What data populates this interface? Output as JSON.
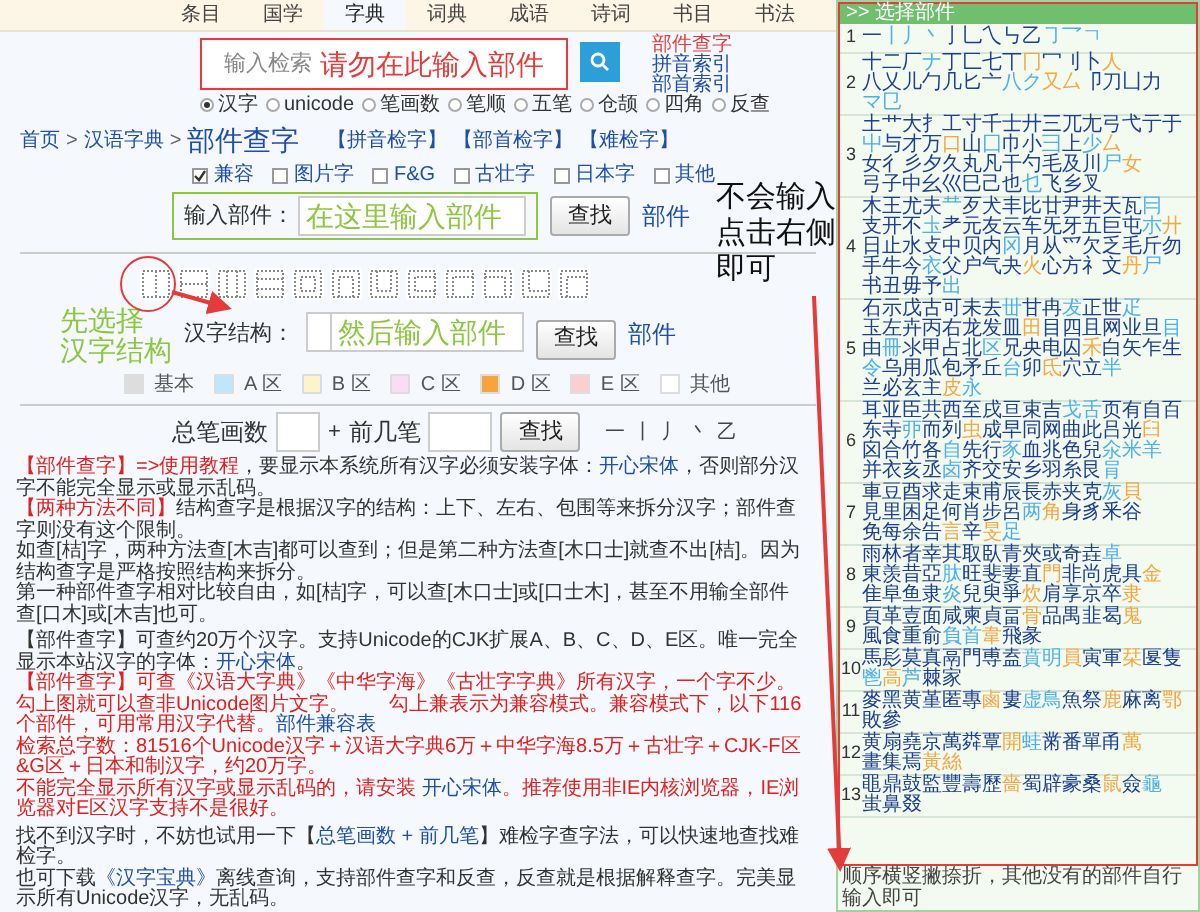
{
  "nav": [
    {
      "label": "条目",
      "selected": false
    },
    {
      "label": "国学",
      "selected": false
    },
    {
      "label": "字典",
      "selected": true
    },
    {
      "label": "词典",
      "selected": false
    },
    {
      "label": "成语",
      "selected": false
    },
    {
      "label": "诗词",
      "selected": false
    },
    {
      "label": "书目",
      "selected": false
    },
    {
      "label": "书法",
      "selected": false
    }
  ],
  "search": {
    "placeholder": "输入检索",
    "annotation": "请勿在此输入部件",
    "links": [
      {
        "label": "部件查字",
        "selected": true
      },
      {
        "label": "拼音索引",
        "selected": false
      },
      {
        "label": "部首索引",
        "selected": false
      }
    ],
    "modes": [
      {
        "label": "汉字",
        "selected": true
      },
      {
        "label": "unicode",
        "selected": false
      },
      {
        "label": "笔画数",
        "selected": false
      },
      {
        "label": "笔顺",
        "selected": false
      },
      {
        "label": "五笔",
        "selected": false
      },
      {
        "label": "仓颉",
        "selected": false
      },
      {
        "label": "四角",
        "selected": false
      },
      {
        "label": "反查",
        "selected": false
      }
    ]
  },
  "breadcrumb": {
    "items": [
      "首页",
      "汉语字典"
    ],
    "separator": ">",
    "current": "部件查字",
    "quick_links": [
      "【拼音检字】",
      "【部首检字】",
      "【难检字】"
    ]
  },
  "filters": [
    {
      "label": "兼容",
      "checked": true
    },
    {
      "label": "图片字",
      "checked": false
    },
    {
      "label": "F&G",
      "checked": false
    },
    {
      "label": "古壮字",
      "checked": false
    },
    {
      "label": "日本字",
      "checked": false
    },
    {
      "label": "其他",
      "checked": false
    }
  ],
  "part_search": {
    "label": "输入部件：",
    "placeholder": "在这里输入部件",
    "button": "查找",
    "link": "部件"
  },
  "side_annotation": [
    "不会输入",
    "点击右侧",
    "即可"
  ],
  "structures": [
    {
      "kind": "left-right"
    },
    {
      "kind": "top-bottom"
    },
    {
      "kind": "left-middle-right"
    },
    {
      "kind": "top-middle-bottom"
    },
    {
      "kind": "enclose"
    },
    {
      "kind": "open-bottom"
    },
    {
      "kind": "open-top"
    },
    {
      "kind": "open-right"
    },
    {
      "kind": "top-left"
    },
    {
      "kind": "top-right"
    },
    {
      "kind": "bottom-left"
    },
    {
      "kind": "overlap"
    }
  ],
  "structure_search": {
    "annotation": [
      "先选择",
      "汉字结构"
    ],
    "label": "汉字结构：",
    "placeholder": "然后输入部件",
    "button": "查找",
    "link": "部件"
  },
  "legend": [
    {
      "label": "基本",
      "color": "#dddddd"
    },
    {
      "label": "A 区",
      "color": "#bfe6fb"
    },
    {
      "label": "B 区",
      "color": "#fdf5c9"
    },
    {
      "label": "C 区",
      "color": "#fbdcf6"
    },
    {
      "label": "D 区",
      "color": "#f7a43c"
    },
    {
      "label": "E 区",
      "color": "#fbcfcf"
    },
    {
      "label": "其他",
      "color": "#ffffff"
    }
  ],
  "stroke_search": {
    "total_label": "总笔画数",
    "plus": "+",
    "first_label": "前几笔",
    "button": "查找",
    "strokes": [
      "一",
      "丨",
      "丿",
      "丶",
      "乙"
    ]
  },
  "notes": [
    [
      [
        {
          "kind": "alert",
          "text": "【部件查字】=>"
        },
        {
          "kind": "alert-link",
          "text": "使用教程"
        },
        {
          "kind": "text",
          "text": "，要显示本系统所有汉字必须安装字体："
        },
        {
          "kind": "link",
          "text": "开心宋体"
        },
        {
          "kind": "text",
          "text": "，否则部分汉字不能完全显示或显示乱码。"
        }
      ],
      [
        {
          "kind": "alert",
          "text": "【两种方法不同】"
        },
        {
          "kind": "text",
          "text": "结构查字是根据汉字的结构：上下、左右、包围等来拆分汉字；部件查字则没有这个限制。"
        }
      ],
      [
        {
          "kind": "text",
          "text": "如查[桔]字，两种方法查[木吉]都可以查到；但是第二种方法查[木口士]就查不出[桔]。因为结构查字是严格按照结构来拆分。"
        }
      ],
      [
        {
          "kind": "text",
          "text": "第一种部件查字相对比较自由，如[桔]字，可以查[木口士]或[口士木]，甚至不用输全部件查[口木]或[木吉]也可。"
        }
      ]
    ],
    [
      [
        {
          "kind": "text",
          "text": "【部件查字】可查约20万个汉字。支持Unicode的CJK扩展A、B、C、D、E区。唯一完全显示本站汉字的字体："
        },
        {
          "kind": "link",
          "text": "开心宋体"
        },
        {
          "kind": "text",
          "text": "。"
        }
      ],
      [
        {
          "kind": "alert",
          "text": "【部件查字】可查《汉语大字典》《中华字海》《古壮字字典》所有汉字，一个字不少。勾上图就可以查非Unicode图片文字。　　勾上兼表示为兼容模式。兼容模式下，以下116个部件，可用常用汉字代替。"
        },
        {
          "kind": "link",
          "text": "部件兼容表"
        }
      ],
      [
        {
          "kind": "alert",
          "text": "检索总字数：81516个Unicode汉字＋汉语大字典6万＋中华字海8.5万＋古壮字＋CJK-F区&G区＋日本和制汉字，约20万字。"
        }
      ],
      [
        {
          "kind": "alert",
          "text": "不能完全显示所有汉字或显示乱码的，请安装 "
        },
        {
          "kind": "link",
          "text": "开心宋体"
        },
        {
          "kind": "alert",
          "text": "。推荐使用非IE内核浏览器，IE浏览器对E区汉字支持不是很好。"
        }
      ]
    ],
    [
      [
        {
          "kind": "text",
          "text": "找不到汉字时，不妨也试用一下【"
        },
        {
          "kind": "link",
          "text": "总笔画数 + 前几笔"
        },
        {
          "kind": "text",
          "text": "】难检字查字法，可以快速地查找难检字。"
        }
      ],
      [
        {
          "kind": "text",
          "text": "也可下载"
        },
        {
          "kind": "link",
          "text": "《汉字宝典》"
        },
        {
          "kind": "text",
          "text": "离线查询，支持部件查字和反查，反查就是根据解释查字。完美显示所有Unicode汉字，无乱码。"
        }
      ]
    ]
  ],
  "panel": {
    "title": ">> 选择部件",
    "footer": "顺序横竖撇捺折，其他没有的部件自行输入即可",
    "groups": [
      {
        "label": "1",
        "parts": [
          {
            "text": "一",
            "color": "#1d3f8f"
          },
          {
            "text": "丨丿丶",
            "color": "#4fb0e8"
          },
          {
            "text": "亅乚乀",
            "color": "#1d3f8f"
          },
          {
            "text": "㇉乙",
            "color": "#1d3f8f"
          },
          {
            "text": "㇆乛ㄱ",
            "color": "#4fb0e8"
          }
        ]
      },
      {
        "label": "2",
        "parts": [
          {
            "text": "十二厂",
            "color": "#1d3f8f"
          },
          {
            "text": "ナ",
            "color": "#4fb0e8"
          },
          {
            "text": "丁匚七丅",
            "color": "#1d3f8f"
          },
          {
            "text": "冂",
            "color": "#f5a742"
          },
          {
            "text": "冖刂卜",
            "color": "#1d3f8f"
          },
          {
            "text": "人",
            "color": "#f5a742"
          },
          {
            "text": "八乂儿勹",
            "color": "#1d3f8f"
          },
          {
            "text": "几匕亠",
            "color": "#1d3f8f"
          },
          {
            "text": "八ク",
            "color": "#4fb0e8"
          },
          {
            "text": "又厶",
            "color": "#f5a742"
          },
          {
            "text": "卩刀凵力",
            "color": "#1d3f8f"
          },
          {
            "text": "マ㔾",
            "color": "#4fb0e8"
          }
        ]
      },
      {
        "label": "3",
        "parts": [
          {
            "text": "土艹大扌",
            "color": "#1d3f8f"
          },
          {
            "text": "工寸千士",
            "color": "#1d3f8f"
          },
          {
            "text": "廾三兀尢",
            "color": "#1d3f8f"
          },
          {
            "text": "弓弋亍于",
            "color": "#1d3f8f"
          },
          {
            "text": "屮",
            "color": "#4fb0e8"
          },
          {
            "text": "与才万",
            "color": "#1d3f8f"
          },
          {
            "text": "口",
            "color": "#f5a742"
          },
          {
            "text": "山",
            "color": "#1d3f8f"
          },
          {
            "text": "囗",
            "color": "#4fb0e8"
          },
          {
            "text": "巾小",
            "color": "#1d3f8f"
          },
          {
            "text": "彐",
            "color": "#4fb0e8"
          },
          {
            "text": "上",
            "color": "#1d3f8f"
          },
          {
            "text": "少",
            "color": "#4fb0e8"
          },
          {
            "text": "厶",
            "color": "#f5a742"
          },
          {
            "text": "女彳彡夕",
            "color": "#1d3f8f"
          },
          {
            "text": "久丸凡干",
            "color": "#1d3f8f"
          },
          {
            "text": "勺毛及川",
            "color": "#1d3f8f"
          },
          {
            "text": "尸",
            "color": "#4fb0e8"
          },
          {
            "text": "女",
            "color": "#f5a742"
          },
          {
            "text": "弓子中幺",
            "color": "#1d3f8f"
          },
          {
            "text": "巛巳己也",
            "color": "#1d3f8f"
          },
          {
            "text": "乜",
            "color": "#4fb0e8"
          },
          {
            "text": "飞乡叉",
            "color": "#1d3f8f"
          }
        ]
      },
      {
        "label": "4",
        "parts": [
          {
            "text": "木王尤夫",
            "color": "#1d3f8f"
          },
          {
            "text": "龷",
            "color": "#4fb0e8"
          },
          {
            "text": "歹犬丰比",
            "color": "#1d3f8f"
          },
          {
            "text": "廿尹井天",
            "color": "#1d3f8f"
          },
          {
            "text": "瓦",
            "color": "#1d3f8f"
          },
          {
            "text": "冃",
            "color": "#4fb0e8"
          },
          {
            "text": "支开不",
            "color": "#1d3f8f"
          },
          {
            "text": "圡",
            "color": "#4fb0e8"
          },
          {
            "text": "耂元友云",
            "color": "#1d3f8f"
          },
          {
            "text": "车旡牙五",
            "color": "#1d3f8f"
          },
          {
            "text": "巨屯",
            "color": "#1d3f8f"
          },
          {
            "text": "朩",
            "color": "#4fb0e8"
          },
          {
            "text": "廾",
            "color": "#f5a742"
          },
          {
            "text": "日止水攴",
            "color": "#1d3f8f"
          },
          {
            "text": "中贝内",
            "color": "#1d3f8f"
          },
          {
            "text": "冈",
            "color": "#4fb0e8"
          },
          {
            "text": "月从爫欠",
            "color": "#1d3f8f"
          },
          {
            "text": "乏毛斤勿",
            "color": "#1d3f8f"
          },
          {
            "text": "手牛今",
            "color": "#1d3f8f"
          },
          {
            "text": "衣",
            "color": "#4fb0e8"
          },
          {
            "text": "父户气夬",
            "color": "#1d3f8f"
          },
          {
            "text": "火",
            "color": "#f5a742"
          },
          {
            "text": "心方礻文",
            "color": "#1d3f8f"
          },
          {
            "text": "丹",
            "color": "#f5a742"
          },
          {
            "text": "尸",
            "color": "#4fb0e8"
          },
          {
            "text": "书丑毋予",
            "color": "#1d3f8f"
          },
          {
            "text": "出",
            "color": "#4fb0e8"
          }
        ]
      },
      {
        "label": "5",
        "parts": [
          {
            "text": "石示戊古",
            "color": "#1d3f8f"
          },
          {
            "text": "可未去",
            "color": "#1d3f8f"
          },
          {
            "text": "丗",
            "color": "#4fb0e8"
          },
          {
            "text": "甘冉",
            "color": "#1d3f8f"
          },
          {
            "text": "犮",
            "color": "#4fb0e8"
          },
          {
            "text": "正世",
            "color": "#1d3f8f"
          },
          {
            "text": "疋",
            "color": "#4fb0e8"
          },
          {
            "text": "玉左卉丙",
            "color": "#1d3f8f"
          },
          {
            "text": "右龙发皿",
            "color": "#1d3f8f"
          },
          {
            "text": "田",
            "color": "#f5a742"
          },
          {
            "text": "目四且网",
            "color": "#1d3f8f"
          },
          {
            "text": "业旦",
            "color": "#1d3f8f"
          },
          {
            "text": "目",
            "color": "#4fb0e8"
          },
          {
            "text": "由",
            "color": "#1d3f8f"
          },
          {
            "text": "冊",
            "color": "#4fb0e8"
          },
          {
            "text": "氺甲占北",
            "color": "#1d3f8f"
          },
          {
            "text": "区",
            "color": "#4fb0e8"
          },
          {
            "text": "兄央电囚",
            "color": "#1d3f8f"
          },
          {
            "text": "禾",
            "color": "#f5a742"
          },
          {
            "text": "白矢乍生",
            "color": "#1d3f8f"
          },
          {
            "text": "令",
            "color": "#4fb0e8"
          },
          {
            "text": "乌用瓜包",
            "color": "#1d3f8f"
          },
          {
            "text": "矛丘",
            "color": "#1d3f8f"
          },
          {
            "text": "台",
            "color": "#4fb0e8"
          },
          {
            "text": "卯",
            "color": "#1d3f8f"
          },
          {
            "text": "氐",
            "color": "#f5a742"
          },
          {
            "text": "穴立",
            "color": "#1d3f8f"
          },
          {
            "text": "半",
            "color": "#4fb0e8"
          },
          {
            "text": "兰必玄主",
            "color": "#1d3f8f"
          },
          {
            "text": "皮",
            "color": "#f5a742"
          },
          {
            "text": "永",
            "color": "#4fb0e8"
          }
        ]
      },
      {
        "label": "6",
        "parts": [
          {
            "text": "耳亚臣共",
            "color": "#1d3f8f"
          },
          {
            "text": "西至戌亘",
            "color": "#1d3f8f"
          },
          {
            "text": "束吉",
            "color": "#1d3f8f"
          },
          {
            "text": "戈舌",
            "color": "#4fb0e8"
          },
          {
            "text": "页有自百",
            "color": "#1d3f8f"
          },
          {
            "text": "东寺",
            "color": "#1d3f8f"
          },
          {
            "text": "丣",
            "color": "#4fb0e8"
          },
          {
            "text": "而列",
            "color": "#1d3f8f"
          },
          {
            "text": "虫",
            "color": "#f5a742"
          },
          {
            "text": "成早同网",
            "color": "#1d3f8f"
          },
          {
            "text": "曲此吕光",
            "color": "#1d3f8f"
          },
          {
            "text": "臼",
            "color": "#f5a742"
          },
          {
            "text": "囟合竹各",
            "color": "#1d3f8f"
          },
          {
            "text": "自",
            "color": "#4fb0e8"
          },
          {
            "text": "先行",
            "color": "#1d3f8f"
          },
          {
            "text": "豕",
            "color": "#4fb0e8"
          },
          {
            "text": "血兆色兒",
            "color": "#1d3f8f"
          },
          {
            "text": "氽米羊",
            "color": "#4fb0e8"
          },
          {
            "text": "并衣亥丞",
            "color": "#1d3f8f"
          },
          {
            "text": "卤",
            "color": "#4fb0e8"
          },
          {
            "text": "齐交安乡",
            "color": "#1d3f8f"
          },
          {
            "text": "羽糸艮",
            "color": "#1d3f8f"
          },
          {
            "text": "肙",
            "color": "#4fb0e8"
          }
        ]
      },
      {
        "label": "7",
        "parts": [
          {
            "text": "車豆酉求",
            "color": "#1d3f8f"
          },
          {
            "text": "走束甫辰",
            "color": "#1d3f8f"
          },
          {
            "text": "長赤夹克",
            "color": "#1d3f8f"
          },
          {
            "text": "灰",
            "color": "#4fb0e8"
          },
          {
            "text": "貝",
            "color": "#f5a742"
          },
          {
            "text": "見里困足",
            "color": "#1d3f8f"
          },
          {
            "text": "何肖步呂",
            "color": "#1d3f8f"
          },
          {
            "text": "两",
            "color": "#4fb0e8"
          },
          {
            "text": "角",
            "color": "#f5a742"
          },
          {
            "text": "身豸釆谷",
            "color": "#1d3f8f"
          },
          {
            "text": "免每余告",
            "color": "#1d3f8f"
          },
          {
            "text": "言",
            "color": "#f5a742"
          },
          {
            "text": "辛",
            "color": "#1d3f8f"
          },
          {
            "text": "旻",
            "color": "#f5a742"
          },
          {
            "text": "足",
            "color": "#4fb0e8"
          }
        ]
      },
      {
        "label": "8",
        "parts": [
          {
            "text": "雨林者幸",
            "color": "#1d3f8f"
          },
          {
            "text": "其取臥青",
            "color": "#1d3f8f"
          },
          {
            "text": "夾或奇垚",
            "color": "#1d3f8f"
          },
          {
            "text": "卓",
            "color": "#4fb0e8"
          },
          {
            "text": "東羡昔亞",
            "color": "#1d3f8f"
          },
          {
            "text": "肽",
            "color": "#4fb0e8"
          },
          {
            "text": "旺斐妻直",
            "color": "#1d3f8f"
          },
          {
            "text": "門",
            "color": "#f5a742"
          },
          {
            "text": "非尚虎具",
            "color": "#1d3f8f"
          },
          {
            "text": "金",
            "color": "#f5a742"
          },
          {
            "text": "隹阜鱼隶",
            "color": "#1d3f8f"
          },
          {
            "text": "炎",
            "color": "#4fb0e8"
          },
          {
            "text": "兒臾爭",
            "color": "#1d3f8f"
          },
          {
            "text": "炊",
            "color": "#f5a742"
          },
          {
            "text": "肩享京卒",
            "color": "#1d3f8f"
          },
          {
            "text": "隶",
            "color": "#f5a742"
          }
        ]
      },
      {
        "label": "9",
        "parts": [
          {
            "text": "頁革壴面",
            "color": "#1d3f8f"
          },
          {
            "text": "咸柬貞畐",
            "color": "#1d3f8f"
          },
          {
            "text": "骨",
            "color": "#f5a742"
          },
          {
            "text": "品禺韭曷",
            "color": "#1d3f8f"
          },
          {
            "text": "鬼",
            "color": "#f5a742"
          },
          {
            "text": "風食重俞",
            "color": "#1d3f8f"
          },
          {
            "text": "負首",
            "color": "#4fb0e8"
          },
          {
            "text": "韋",
            "color": "#f5a742"
          },
          {
            "text": "飛彖",
            "color": "#1d3f8f"
          }
        ]
      },
      {
        "label": "10",
        "parts": [
          {
            "text": "馬髟莫真",
            "color": "#1d3f8f"
          },
          {
            "text": "鬲門尃盍",
            "color": "#1d3f8f"
          },
          {
            "text": "賁明",
            "color": "#4fb0e8"
          },
          {
            "text": "員",
            "color": "#f5a742"
          },
          {
            "text": "寅軍",
            "color": "#1d3f8f"
          },
          {
            "text": "栞",
            "color": "#f5a742"
          },
          {
            "text": "匽隻",
            "color": "#1d3f8f"
          },
          {
            "text": "鬯",
            "color": "#4fb0e8"
          },
          {
            "text": "高",
            "color": "#f5a742"
          },
          {
            "text": "芦",
            "color": "#4fb0e8"
          },
          {
            "text": "棘家",
            "color": "#1d3f8f"
          }
        ]
      },
      {
        "label": "11",
        "parts": [
          {
            "text": "麥黑黄堇",
            "color": "#1d3f8f"
          },
          {
            "text": "匿專",
            "color": "#1d3f8f"
          },
          {
            "text": "鹵",
            "color": "#f5a742"
          },
          {
            "text": "婁",
            "color": "#1d3f8f"
          },
          {
            "text": "虚鳥",
            "color": "#4fb0e8"
          },
          {
            "text": "魚祭",
            "color": "#1d3f8f"
          },
          {
            "text": "鹿",
            "color": "#f5a742"
          },
          {
            "text": "麻离",
            "color": "#1d3f8f"
          },
          {
            "text": "鄂",
            "color": "#f5a742"
          },
          {
            "text": "敗參",
            "color": "#1d3f8f"
          }
        ]
      },
      {
        "label": "12",
        "parts": [
          {
            "text": "黄扇堯京",
            "color": "#1d3f8f"
          },
          {
            "text": "萬粦覃",
            "color": "#1d3f8f"
          },
          {
            "text": "開",
            "color": "#f5a742"
          },
          {
            "text": "蛙",
            "color": "#4fb0e8"
          },
          {
            "text": "黹番單甬",
            "color": "#1d3f8f"
          },
          {
            "text": "萬",
            "color": "#f5a742"
          },
          {
            "text": "畫集焉",
            "color": "#1d3f8f"
          },
          {
            "text": "黃",
            "color": "#f5a742"
          },
          {
            "text": "絲",
            "color": "#f5a742"
          }
        ]
      },
      {
        "label": "13",
        "parts": [
          {
            "text": "黽鼎鼓監",
            "color": "#1d3f8f"
          },
          {
            "text": "豐壽歷",
            "color": "#1d3f8f"
          },
          {
            "text": "嗇",
            "color": "#f5a742"
          },
          {
            "text": "蜀辟豪桑",
            "color": "#1d3f8f"
          },
          {
            "text": "鼠",
            "color": "#f5a742"
          },
          {
            "text": "僉",
            "color": "#1d3f8f"
          },
          {
            "text": "龜",
            "color": "#4fb0e8"
          },
          {
            "text": "蚩鼻叕",
            "color": "#1d3f8f"
          }
        ]
      }
    ]
  }
}
